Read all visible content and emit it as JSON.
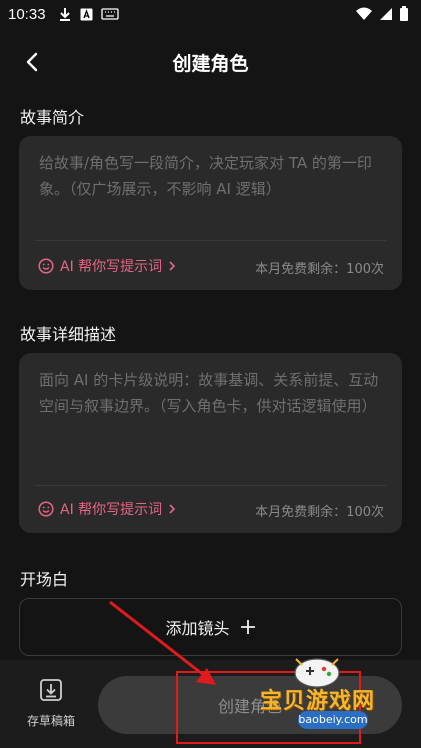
{
  "status_bar": {
    "time": "10:33"
  },
  "header": {
    "title": "创建角色"
  },
  "story_intro": {
    "label": "故事简介",
    "placeholder": "给故事/角色写一段简介，决定玩家对 TA 的第一印象。（仅广场展示，不影响 AI 逻辑）",
    "ai_helper": "AI 帮你写提示词",
    "quota": "本月免费剩余：100次"
  },
  "story_detail": {
    "label": "故事详细描述",
    "placeholder": "面向 AI 的卡片级说明：故事基调、关系前提、互动空间与叙事边界。（写入角色卡，供对话逻辑使用）",
    "ai_helper": "AI 帮你写提示词",
    "quota": "本月免费剩余：100次"
  },
  "opening": {
    "label": "开场白",
    "add_shot": "添加镜头",
    "add_icon": "plus-icon"
  },
  "bottom_bar": {
    "drafts_label": "存草稿箱",
    "create_label": "创建角色"
  },
  "watermark": {
    "text": "宝贝游戏网",
    "url": "baobeiy.com"
  },
  "colors": {
    "background": "#141414",
    "card": "#2a2a2a",
    "accent_pink": "#e56585",
    "annotation_red": "#e11b1b"
  }
}
